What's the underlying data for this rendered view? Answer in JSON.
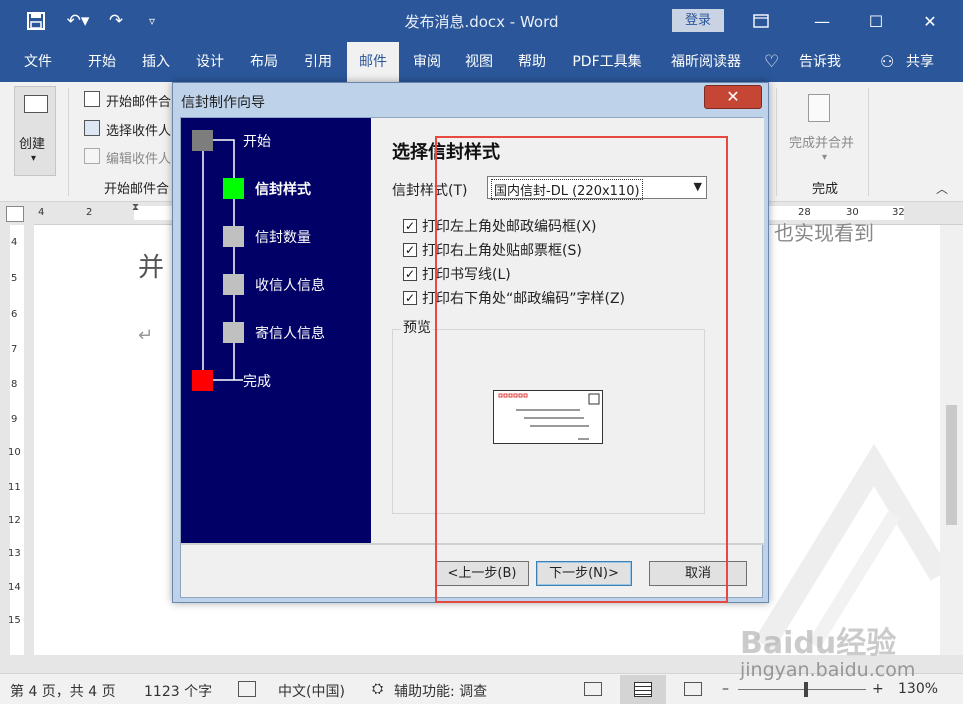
{
  "window": {
    "title": "发布消息.docx - Word",
    "login": "登录",
    "colors": {
      "accent": "#2b579a",
      "ribbon_bg": "#f1f1f1"
    }
  },
  "tabs": [
    "文件",
    "开始",
    "插入",
    "设计",
    "布局",
    "引用",
    "邮件",
    "审阅",
    "视图",
    "帮助",
    "PDF工具集",
    "福昕阅读器",
    "告诉我"
  ],
  "active_tab": "邮件",
  "share": "共享",
  "ribbon": {
    "create": "创建",
    "start_merge": "开始邮件合",
    "select_recipients": "选择收件人",
    "edit_recipients": "编辑收件人",
    "group_start": "开始邮件合",
    "finish_merge": "完成并合并",
    "group_finish": "完成"
  },
  "ruler": {
    "h_ticks": [
      "4",
      "2",
      "28",
      "30",
      "32"
    ],
    "v_ticks": [
      "4",
      "5",
      "6",
      "7",
      "8",
      "9",
      "10",
      "11",
      "12",
      "13",
      "14",
      "15"
    ]
  },
  "document": {
    "text_fragment": "并",
    "right_fragment": "也实现看到",
    "return_mark": "↵"
  },
  "dialog": {
    "title": "信封制作向导",
    "close": "✕",
    "steps": [
      "开始",
      "信封样式",
      "信封数量",
      "收信人信息",
      "寄信人信息",
      "完成"
    ],
    "current_step": "信封样式",
    "heading": "选择信封样式",
    "style_label": "信封样式(T)",
    "style_value": "国内信封-DL (220x110)",
    "options": [
      {
        "label": "打印左上角处邮政编码框(X)",
        "checked": true
      },
      {
        "label": "打印右上角处贴邮票框(S)",
        "checked": true
      },
      {
        "label": "打印书写线(L)",
        "checked": true
      },
      {
        "label": "打印右下角处“邮政编码”字样(Z)",
        "checked": true
      }
    ],
    "preview_label": "预览",
    "buttons": {
      "prev": "<上一步(B)",
      "next": "下一步(N)>",
      "cancel": "取消"
    }
  },
  "status": {
    "page": "第 4 页，共 4 页",
    "words": "1123 个字",
    "language": "中文(中国)",
    "accessibility": "辅助功能: 调查",
    "zoom": "130%"
  },
  "watermark": {
    "brand": "Baidu经验",
    "url": "jingyan.baidu.com"
  }
}
